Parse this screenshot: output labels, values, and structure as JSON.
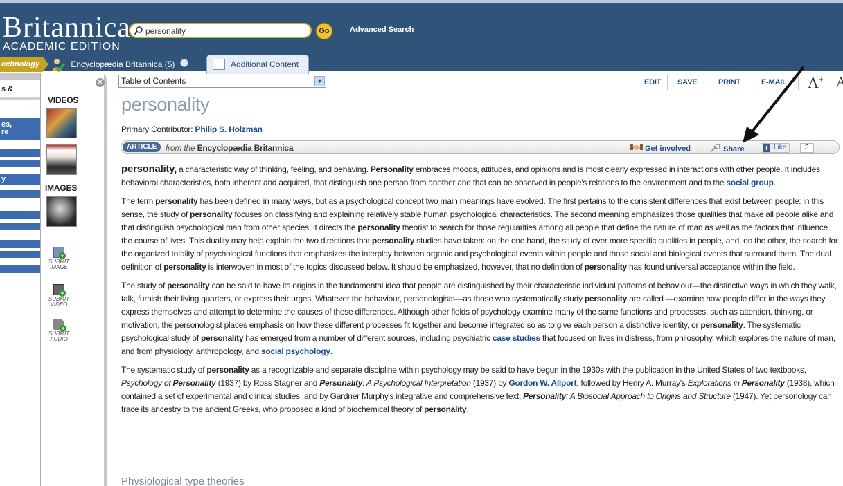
{
  "header": {
    "logo": "Britannica",
    "logo_sub": "ACADEMIC EDITION",
    "search_value": "personality",
    "go_label": "Go",
    "advanced_search": "Advanced Search"
  },
  "tabs": {
    "technology": "echnology",
    "encyclopaedia": "Encyclopædia Britannica",
    "encyclopaedia_count": "(5)",
    "additional_content": "Additional Content"
  },
  "left_panel": {
    "close_glyph": "✕",
    "fragments": [
      "s &",
      "es,",
      "re",
      "y"
    ],
    "videos_title": "VIDEOS",
    "images_title": "IMAGES",
    "submit_image": [
      "SUBMIT",
      "IMAGE"
    ],
    "submit_video": [
      "SUBMIT",
      "VIDEO"
    ],
    "submit_audio": [
      "SUBMIT",
      "AUDIO"
    ]
  },
  "toolbar": {
    "toc_selected": "Table of Contents",
    "edit": "EDIT",
    "save": "SAVE",
    "print": "PRINT",
    "email": "E-MAIL",
    "font_up": "A",
    "font_down": "A"
  },
  "article": {
    "title": "personality",
    "contributor_label": "Primary Contributor:",
    "contributor_name": "Philip S. Holzman",
    "badge": "ARTICLE",
    "from_prefix": "from the",
    "from_source": "Encyclopædia Britannica",
    "get_involved": "Get involved",
    "share": "Share",
    "like": "Like",
    "like_count": "3",
    "subhead": "Physiological type theories"
  },
  "colors": {
    "header_bg": "#2f5379",
    "link": "#1c4a8a",
    "accent_gold": "#f3c22a"
  }
}
